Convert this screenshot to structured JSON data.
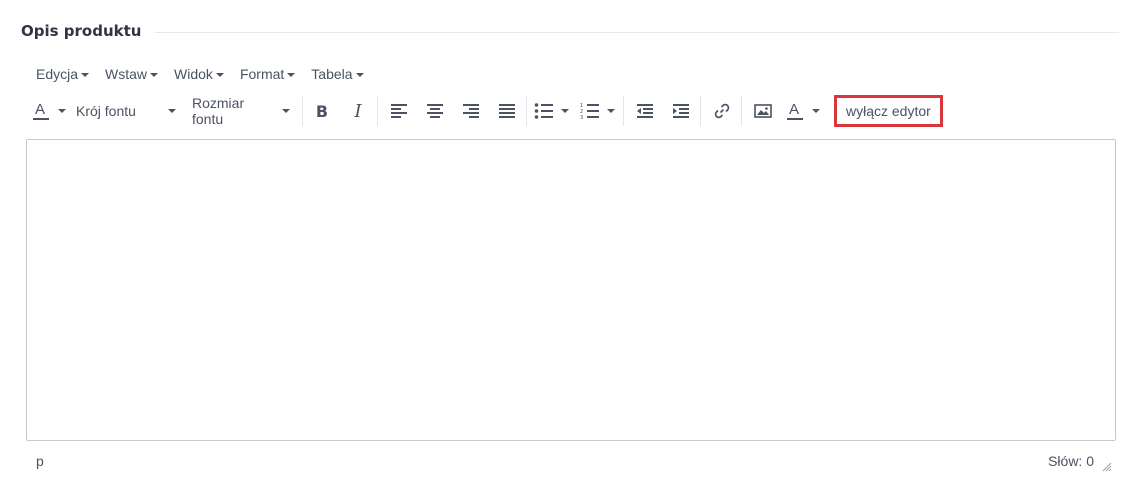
{
  "section": {
    "title": "Opis produktu"
  },
  "menubar": {
    "items": [
      {
        "label": "Edycja"
      },
      {
        "label": "Wstaw"
      },
      {
        "label": "Widok"
      },
      {
        "label": "Format"
      },
      {
        "label": "Tabela"
      }
    ]
  },
  "toolbar": {
    "font_family_label": "Krój fontu",
    "font_size_label": "Rozmiar fontu",
    "text_color_letter": "A",
    "bg_color_letter": "A",
    "toggle_editor_label": "wyłącz edytor",
    "colors": {
      "text_color_underline": "#4a5263",
      "highlight_border": "#d9363e"
    }
  },
  "editor": {
    "content": ""
  },
  "statusbar": {
    "path": "p",
    "word_count": "Słów: 0"
  }
}
